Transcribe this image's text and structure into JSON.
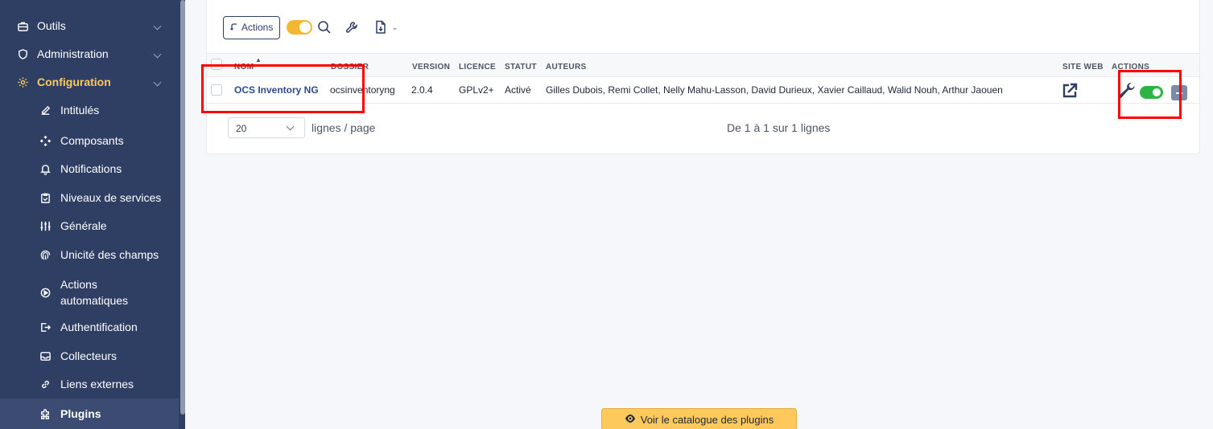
{
  "sidebar": {
    "sections": [
      {
        "label": "Outils",
        "icon": "briefcase-icon"
      },
      {
        "label": "Administration",
        "icon": "shield-icon"
      },
      {
        "label": "Configuration",
        "icon": "gear-icon"
      }
    ],
    "items": [
      {
        "label": "Intitulés",
        "icon": "edit-icon"
      },
      {
        "label": "Composants",
        "icon": "components-icon"
      },
      {
        "label": "Notifications",
        "icon": "bell-icon"
      },
      {
        "label": "Niveaux de services",
        "icon": "clipboard-check-icon"
      },
      {
        "label": "Générale",
        "icon": "adjustments-icon"
      },
      {
        "label": "Unicité des champs",
        "icon": "fingerprint-icon"
      },
      {
        "label_line1": "Actions",
        "label_line2": "automatiques",
        "icon": "automation-icon"
      },
      {
        "label": "Authentification",
        "icon": "login-icon"
      },
      {
        "label": "Collecteurs",
        "icon": "inbox-icon"
      },
      {
        "label": "Liens externes",
        "icon": "link-icon"
      },
      {
        "label": "Plugins",
        "icon": "puzzle-icon"
      }
    ]
  },
  "toolbar": {
    "actions_label": "Actions"
  },
  "table": {
    "headers": {
      "name": "NOM",
      "folder": "DOSSIER",
      "version": "VERSION",
      "license": "LICENCE",
      "status": "STATUT",
      "authors": "AUTEURS",
      "website": "SITE WEB",
      "actions": "ACTIONS"
    },
    "rows": [
      {
        "name": "OCS Inventory NG",
        "folder": "ocsinventoryng",
        "version": "2.0.4",
        "license": "GPLv2+",
        "status": "Activé",
        "authors": "Gilles Dubois, Remi Collet, Nelly Mahu-Lasson, David Durieux, Xavier Caillaud, Walid Nouh, Arthur Jaouen"
      }
    ]
  },
  "pagination": {
    "per_page": "20",
    "per_page_label": "lignes / page",
    "count_text": "De 1 à 1 sur 1 lignes"
  },
  "catalog_button": "Voir le catalogue des plugins",
  "colors": {
    "sidebar_bg": "#2f3f64",
    "accent": "#fec95c",
    "toggle_active": "#2fb344",
    "annotation": "#ff0000"
  }
}
